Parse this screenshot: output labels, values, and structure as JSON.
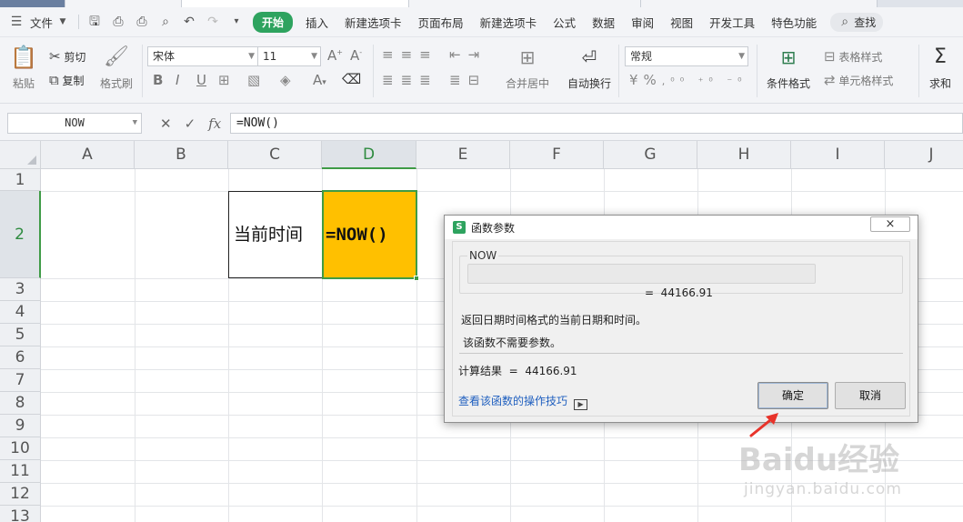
{
  "menubar": {
    "file": "文件",
    "start": "开始",
    "items": [
      "插入",
      "新建选项卡",
      "页面布局",
      "新建选项卡",
      "公式",
      "数据",
      "审阅",
      "视图",
      "开发工具",
      "特色功能"
    ],
    "search": "查找"
  },
  "ribbon": {
    "paste": "粘贴",
    "cut": "剪切",
    "copy": "复制",
    "format_painter": "格式刷",
    "font_name": "宋体",
    "font_size": "11",
    "merge_center": "合并居中",
    "wrap_text": "自动换行",
    "number_format": "常规",
    "conditional_format": "条件格式",
    "table_style": "表格样式",
    "cell_style": "单元格样式",
    "sum": "求和"
  },
  "formula_bar": {
    "name_box": "NOW",
    "fx": "fx",
    "formula": "=NOW()"
  },
  "sheet": {
    "columns": [
      "A",
      "B",
      "C",
      "D",
      "E",
      "F",
      "G",
      "H",
      "I",
      "J"
    ],
    "rows": [
      "1",
      "2",
      "3",
      "4",
      "5",
      "6",
      "7",
      "8",
      "9",
      "10",
      "11",
      "12",
      "13"
    ],
    "selected_column": "D",
    "selected_row": "2",
    "cell_C2": "当前时间",
    "cell_D2": "=NOW()",
    "highlight_color": "#ffc000",
    "selection_color": "#3f9b46"
  },
  "dialog": {
    "title": "函数参数",
    "close": "×",
    "group_label": "NOW",
    "value_line": "=  44166.91",
    "description": "返回日期时间格式的当前日期和时间。",
    "note": "该函数不需要参数。",
    "result_line": "计算结果  =  44166.91",
    "help_link": "查看该函数的操作技巧",
    "ok": "确定",
    "cancel": "取消"
  },
  "watermark": {
    "logo": "Baidu经验",
    "url": "jingyan.baidu.com"
  }
}
